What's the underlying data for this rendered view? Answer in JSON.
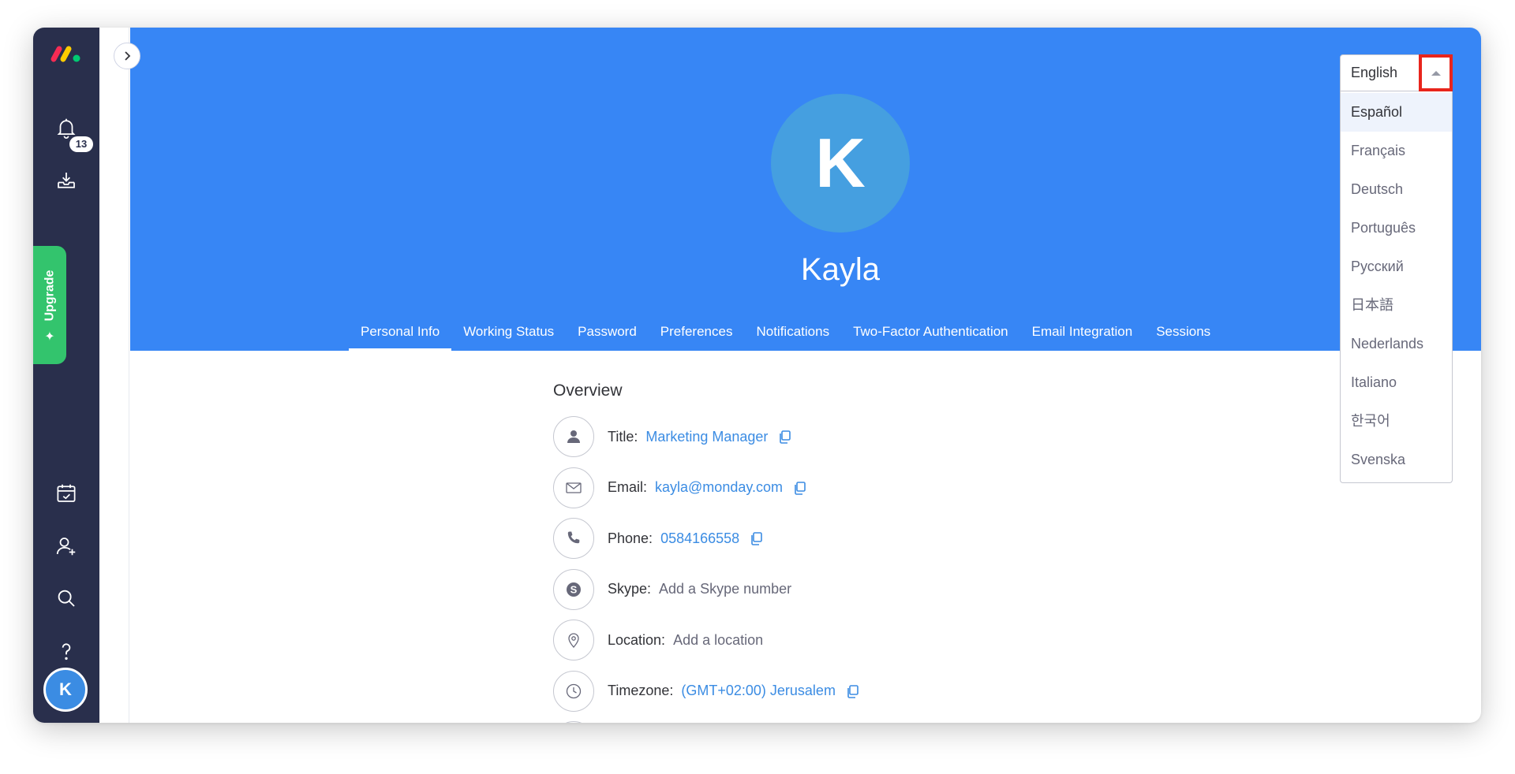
{
  "sidebar": {
    "badge_count": "13",
    "upgrade_label": "Upgrade",
    "avatar_initial": "K",
    "logo_colors": [
      "#f62b54",
      "#ffcc00",
      "#00ca72"
    ]
  },
  "profile": {
    "avatar_initial": "K",
    "name": "Kayla"
  },
  "tabs": [
    {
      "label": "Personal Info",
      "active": true
    },
    {
      "label": "Working Status"
    },
    {
      "label": "Password"
    },
    {
      "label": "Preferences"
    },
    {
      "label": "Notifications"
    },
    {
      "label": "Two-Factor Authentication"
    },
    {
      "label": "Email Integration"
    },
    {
      "label": "Sessions"
    }
  ],
  "overview": {
    "title": "Overview",
    "rows": [
      {
        "icon": "person-icon",
        "label": "Title:",
        "value": "Marketing Manager",
        "placeholder": false,
        "copy": true
      },
      {
        "icon": "email-icon",
        "label": "Email:",
        "value": "kayla@monday.com",
        "placeholder": false,
        "copy": true
      },
      {
        "icon": "phone-icon",
        "label": "Phone:",
        "value": "0584166558",
        "placeholder": false,
        "copy": true
      },
      {
        "icon": "skype-icon",
        "label": "Skype:",
        "value": "Add a Skype number",
        "placeholder": true,
        "copy": false
      },
      {
        "icon": "location-icon",
        "label": "Location:",
        "value": "Add a location",
        "placeholder": true,
        "copy": false
      },
      {
        "icon": "clock-icon",
        "label": "Timezone:",
        "value": "(GMT+02:00) Jerusalem",
        "placeholder": false,
        "copy": true
      }
    ]
  },
  "language": {
    "selected": "English",
    "options": [
      "Español",
      "Français",
      "Deutsch",
      "Português",
      "Русский",
      "日本語",
      "Nederlands",
      "Italiano",
      "한국어",
      "Svenska"
    ],
    "highlighted": "Español"
  },
  "colors": {
    "header_blue": "#3786f5",
    "sidebar_dark": "#292f4c",
    "upgrade_green": "#33c46d",
    "link_blue": "#3b8ce3",
    "highlight_red": "#e8251c"
  }
}
